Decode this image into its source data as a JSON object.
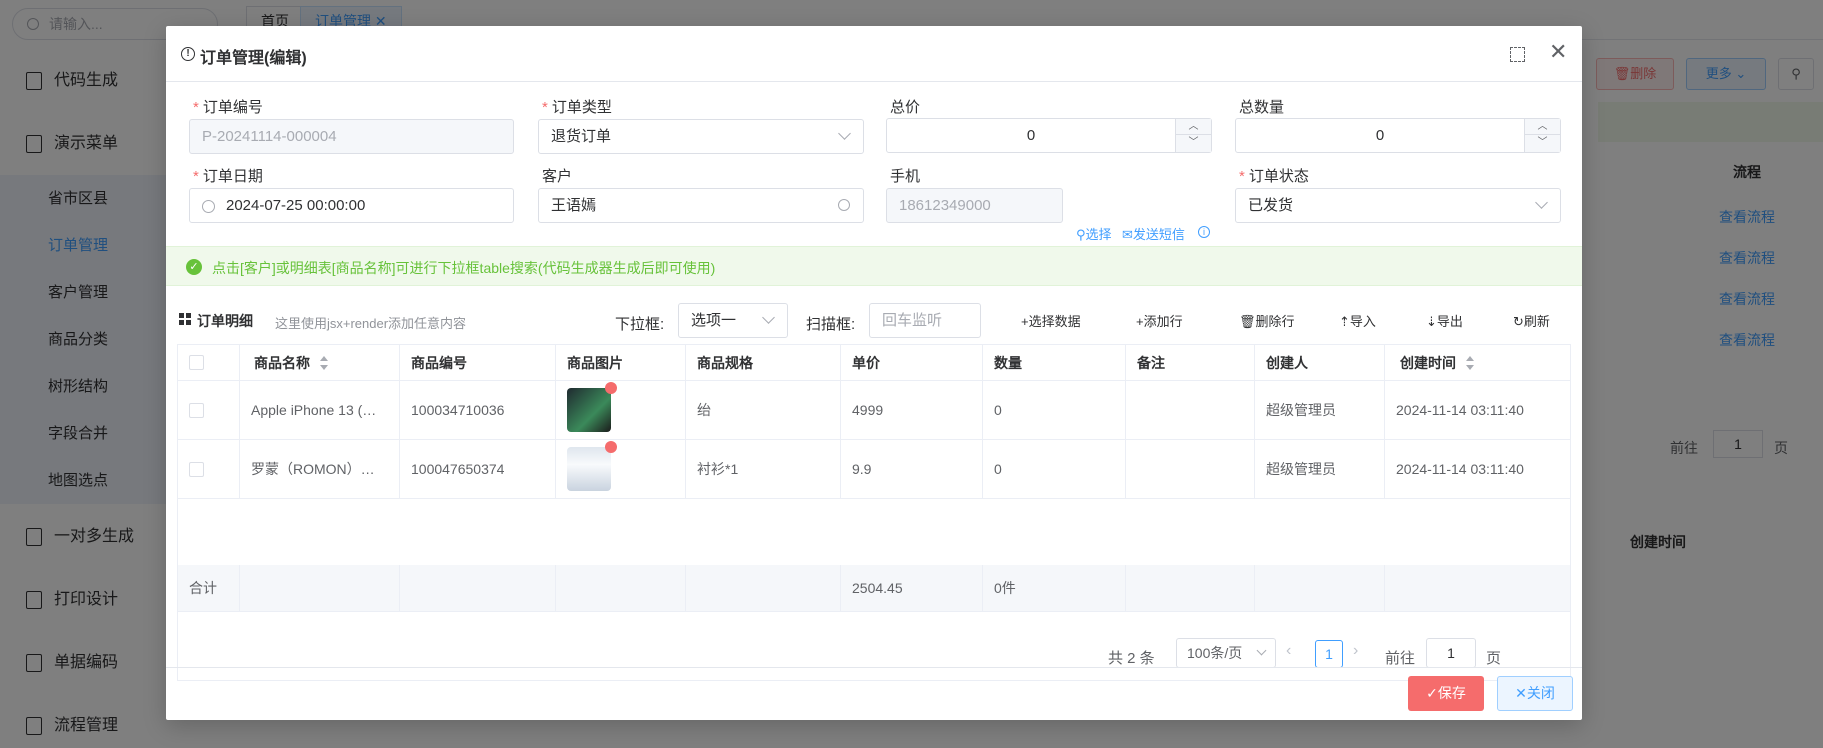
{
  "app": {
    "search_placeholder": "请输入...",
    "menu": [
      {
        "label": "代码生成"
      },
      {
        "label": "演示菜单"
      },
      {
        "label": "一对多生成"
      },
      {
        "label": "打印设计"
      },
      {
        "label": "单据编码"
      },
      {
        "label": "流程管理"
      }
    ],
    "submenu": [
      "省市区县",
      "订单管理",
      "客户管理",
      "商品分类",
      "树形结构",
      "字段合并",
      "地图选点"
    ],
    "tabs": [
      "首页",
      "订单管理"
    ],
    "bg_buttons": {
      "delete": "删除",
      "more": "更多"
    },
    "bg_table": {
      "col_flow": "流程",
      "flow_link": "查看流程",
      "col_created": "创建时间",
      "goto": "前往",
      "page_unit": "页",
      "page_num": "1"
    }
  },
  "dialog": {
    "title": "订单管理(编辑)",
    "fields": {
      "order_no": {
        "label": "订单编号",
        "value": "P-20241114-000004"
      },
      "order_type": {
        "label": "订单类型",
        "value": "退货订单"
      },
      "total_price": {
        "label": "总价",
        "value": "0"
      },
      "total_qty": {
        "label": "总数量",
        "value": "0"
      },
      "order_date": {
        "label": "订单日期",
        "value": "2024-07-25 00:00:00"
      },
      "customer": {
        "label": "客户",
        "value": "王语嫣"
      },
      "phone": {
        "label": "手机",
        "value": "18612349000",
        "select_link": "选择",
        "sms_link": "发送短信"
      },
      "order_status": {
        "label": "订单状态",
        "value": "已发货"
      }
    },
    "alert": "点击[客户]或明细表[商品名称]可进行下拉框table搜索(代码生成器生成后即可使用)",
    "detail_toolbar": {
      "title": "订单明细",
      "hint": "这里使用jsx+render添加任意内容",
      "dropdown_label": "下拉框:",
      "dropdown_value": "选项一",
      "scan_label": "扫描框:",
      "scan_placeholder": "回车监听",
      "buttons": [
        "+选择数据",
        "+添加行",
        "删除行",
        "导入",
        "导出",
        "刷新"
      ]
    },
    "table": {
      "columns": [
        "商品名称",
        "商品编号",
        "商品图片",
        "商品规格",
        "单价",
        "数量",
        "备注",
        "创建人",
        "创建时间"
      ],
      "rows": [
        {
          "name": "Apple iPhone 13 (…",
          "code": "100034710036",
          "spec": "绐",
          "price": "4999",
          "qty": "0",
          "remark": "",
          "creator": "超级管理员",
          "created": "2024-11-14 03:11:40"
        },
        {
          "name": "罗蒙（ROMON）…",
          "code": "100047650374",
          "spec": "衬衫*1",
          "price": "9.9",
          "qty": "0",
          "remark": "",
          "creator": "超级管理员",
          "created": "2024-11-14 03:11:40"
        }
      ],
      "footer": {
        "label": "合计",
        "price_sum": "2504.45",
        "qty_sum": "0件"
      }
    },
    "pager": {
      "total": "共 2 条",
      "page_size": "100条/页",
      "current": "1",
      "goto": "前往",
      "goto_value": "1",
      "page_unit": "页"
    },
    "footer": {
      "save": "✓保存",
      "close": "✕关闭"
    }
  }
}
